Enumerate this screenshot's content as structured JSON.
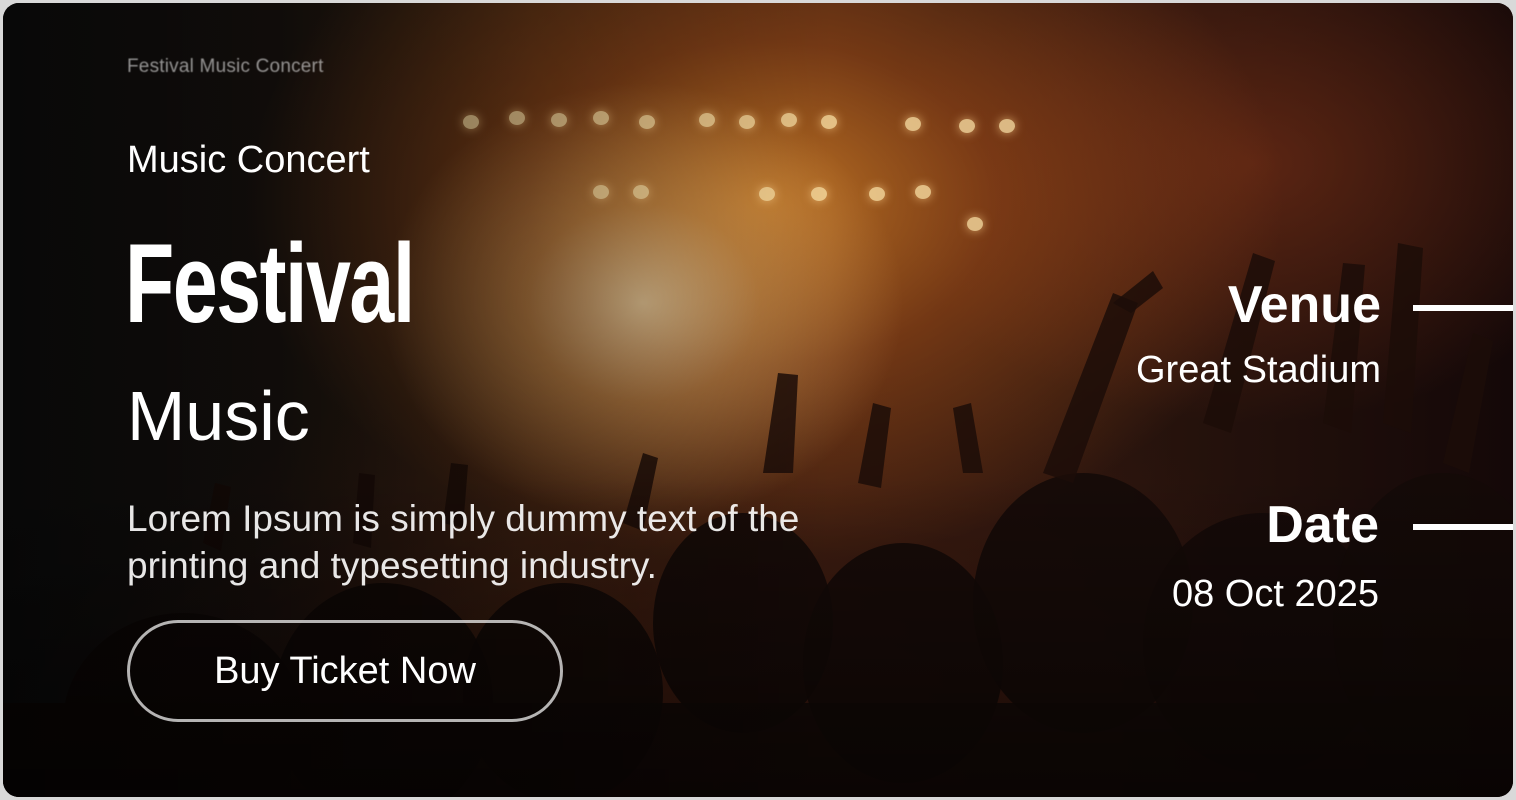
{
  "banner": {
    "watermark": "Festival Music Concert",
    "eyebrow": "Music Concert",
    "headline": "Festival",
    "subheadline": "Music",
    "description": "Lorem Ipsum is simply dummy text of the printing and typesetting industry.",
    "cta_label": "Buy Ticket Now"
  },
  "details": {
    "venue_label": "Venue",
    "venue_value": "Great Stadium",
    "date_label": "Date",
    "date_value": "08 Oct 2025"
  },
  "colors": {
    "text": "#ffffff",
    "accent_glow": "#d6822a"
  }
}
